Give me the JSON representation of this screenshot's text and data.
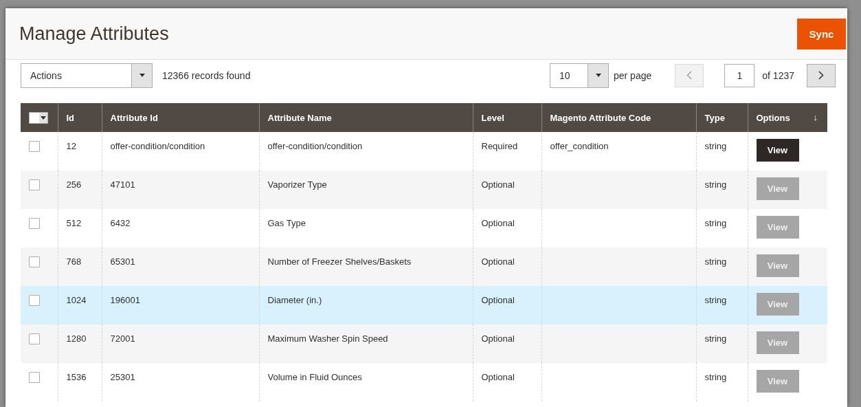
{
  "page": {
    "title": "Manage Attributes",
    "sync_button": "Sync"
  },
  "toolbar": {
    "actions": {
      "value": "Actions"
    },
    "records_found": "12366 records found",
    "per_page": {
      "value": "10",
      "label": "per page"
    },
    "pager": {
      "previous": {
        "disabled": true
      },
      "page": "1",
      "total": "of 1237",
      "next": {
        "disabled": false
      }
    }
  },
  "table": {
    "select_all": {
      "checked": false
    },
    "columns": [
      {
        "label": "Id"
      },
      {
        "label": "Attribute Id"
      },
      {
        "label": "Attribute Name"
      },
      {
        "label": "Level"
      },
      {
        "label": "Magento Attribute Code"
      },
      {
        "label": "Type"
      },
      {
        "label": "Options",
        "sort_indicator": "↓"
      }
    ],
    "rows": [
      {
        "checked": false,
        "highlighted": false,
        "id": "12",
        "attribute_id": "offer-condition/condition",
        "attribute_name": "offer-condition/condition",
        "level": "Required",
        "magento_code": "offer_condition",
        "type": "string",
        "action": {
          "label": "View",
          "disabled": false
        }
      },
      {
        "checked": false,
        "highlighted": false,
        "id": "256",
        "attribute_id": "47101",
        "attribute_name": "Vaporizer Type",
        "level": "Optional",
        "type": "string",
        "action": {
          "label": "View",
          "disabled": true
        }
      },
      {
        "checked": false,
        "highlighted": false,
        "id": "512",
        "attribute_id": "6432",
        "attribute_name": "Gas Type",
        "level": "Optional",
        "type": "string",
        "action": {
          "label": "View",
          "disabled": true
        }
      },
      {
        "checked": false,
        "highlighted": false,
        "id": "768",
        "attribute_id": "65301",
        "attribute_name": "Number of Freezer Shelves/Baskets",
        "level": "Optional",
        "type": "string",
        "action": {
          "label": "View",
          "disabled": true
        }
      },
      {
        "checked": false,
        "highlighted": true,
        "id": "1024",
        "attribute_id": "196001",
        "attribute_name": "Diameter (in.)",
        "level": "Optional",
        "type": "string",
        "action": {
          "label": "View",
          "disabled": true
        }
      },
      {
        "checked": false,
        "highlighted": false,
        "id": "1280",
        "attribute_id": "72001",
        "attribute_name": "Maximum Washer Spin Speed",
        "level": "Optional",
        "type": "string",
        "action": {
          "label": "View",
          "disabled": true
        }
      },
      {
        "checked": false,
        "highlighted": false,
        "id": "1536",
        "attribute_id": "25301",
        "attribute_name": "Volume in Fluid Ounces",
        "level": "Optional",
        "type": "string",
        "action": {
          "label": "View",
          "disabled": true
        }
      }
    ]
  }
}
